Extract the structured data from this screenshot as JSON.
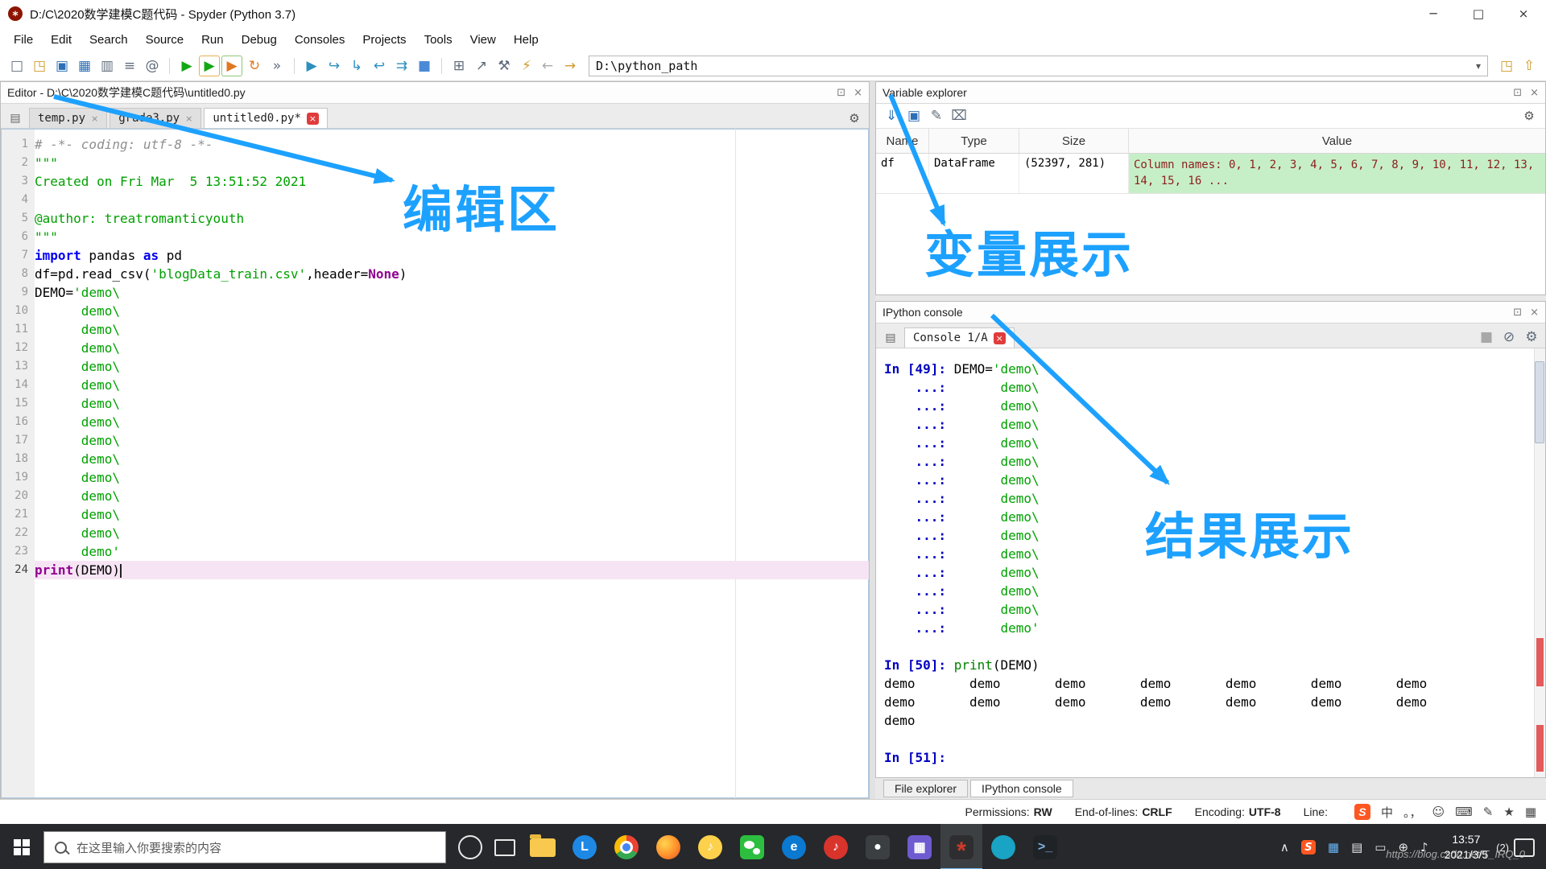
{
  "titlebar": {
    "title": "D:/C\\2020数学建模C题代码 - Spyder (Python 3.7)"
  },
  "icons": {
    "logo": "*",
    "minimize": "─",
    "maximize": "□",
    "close_win": "×",
    "close": "×",
    "gear": "⚙",
    "undock": "⊡",
    "browse": "▤",
    "chevron_down": "▾"
  },
  "menubar": {
    "items": [
      "File",
      "Edit",
      "Search",
      "Source",
      "Run",
      "Debug",
      "Consoles",
      "Projects",
      "Tools",
      "View",
      "Help"
    ]
  },
  "toolbar": {
    "path_value": "D:\\python_path",
    "main_icons": [
      {
        "name": "new-file-icon",
        "g": "□",
        "c": "ic-gray"
      },
      {
        "name": "open-file-icon",
        "g": "◳",
        "c": "ic-gold"
      },
      {
        "name": "save-icon",
        "g": "▣",
        "c": "ic-blue"
      },
      {
        "name": "save-all-icon",
        "g": "▦",
        "c": "ic-blue"
      },
      {
        "name": "copy-icon",
        "g": "▥",
        "c": "ic-gray"
      },
      {
        "name": "file-switcher-icon",
        "g": "≡",
        "c": "ic-gray"
      },
      {
        "name": "symbol-finder-icon",
        "g": "@",
        "c": "ic-gray"
      },
      {
        "name": "toolbar-separator",
        "g": "",
        "c": "tb-sep"
      },
      {
        "name": "run-icon",
        "g": "▶",
        "c": "ic-green"
      },
      {
        "name": "run-cell-icon",
        "g": "▶",
        "c": "ic-cell"
      },
      {
        "name": "run-cell-advance-icon",
        "g": "▶",
        "c": "ic-cell2"
      },
      {
        "name": "rerun-icon",
        "g": "↻",
        "c": "ic-orange"
      },
      {
        "name": "more-actions-icon",
        "g": "»",
        "c": "ic-gray"
      },
      {
        "name": "toolbar-separator",
        "g": "",
        "c": "tb-sep"
      },
      {
        "name": "debug-icon",
        "g": "▶",
        "c": "ic-cyan"
      },
      {
        "name": "step-over-icon",
        "g": "↪",
        "c": "ic-cyan"
      },
      {
        "name": "step-into-icon",
        "g": "↳",
        "c": "ic-cyan"
      },
      {
        "name": "step-return-icon",
        "g": "↩",
        "c": "ic-cyan"
      },
      {
        "name": "continue-icon",
        "g": "⇉",
        "c": "ic-cyan"
      },
      {
        "name": "stop-icon",
        "g": "■",
        "c": "ic-stopblue"
      },
      {
        "name": "toolbar-separator",
        "g": "",
        "c": "tb-sep"
      },
      {
        "name": "panes-icon",
        "g": "⊞",
        "c": "ic-gray"
      },
      {
        "name": "fullscreen-icon",
        "g": "↗",
        "c": "ic-gray"
      },
      {
        "name": "tools-icon",
        "g": "⚒",
        "c": "ic-gray"
      },
      {
        "name": "python-env-icon",
        "g": "⚡",
        "c": "ic-gold"
      }
    ],
    "nav_icons": [
      {
        "name": "back-icon",
        "g": "←",
        "c": "ic-dim"
      },
      {
        "name": "forward-icon",
        "g": "→",
        "c": "ic-gold"
      }
    ],
    "right_icons": [
      {
        "name": "browse-directory-icon",
        "g": "◳",
        "c": "ic-gold"
      },
      {
        "name": "parent-directory-icon",
        "g": "⇧",
        "c": "ic-gold"
      }
    ]
  },
  "editor": {
    "title": "Editor - D:\\C\\2020数学建模C题代码\\untitled0.py",
    "tabs": [
      {
        "label": "temp.py"
      },
      {
        "label": "grade3.py"
      },
      {
        "label": "untitled0.py*",
        "active": true
      }
    ],
    "code": [
      {
        "n": "1",
        "segs": [
          {
            "t": "# -*- coding: utf-8 -*-",
            "c": "cm"
          }
        ]
      },
      {
        "n": "2",
        "segs": [
          {
            "t": "\"\"\"",
            "c": "st"
          }
        ]
      },
      {
        "n": "3",
        "segs": [
          {
            "t": "Created on Fri Mar  5 13:51:52 2021",
            "c": "st"
          }
        ]
      },
      {
        "n": "4",
        "segs": []
      },
      {
        "n": "5",
        "segs": [
          {
            "t": "@author: treatromanticyouth",
            "c": "st"
          }
        ]
      },
      {
        "n": "6",
        "segs": [
          {
            "t": "\"\"\"",
            "c": "st"
          }
        ]
      },
      {
        "n": "7",
        "segs": [
          {
            "t": "import",
            "c": "kw"
          },
          {
            "t": " pandas ",
            "c": "tx"
          },
          {
            "t": "as",
            "c": "kw"
          },
          {
            "t": " pd",
            "c": "tx"
          }
        ]
      },
      {
        "n": "8",
        "segs": [
          {
            "t": "df=pd.read_csv(",
            "c": "tx"
          },
          {
            "t": "'blogData_train.csv'",
            "c": "st"
          },
          {
            "t": ",header=",
            "c": "tx"
          },
          {
            "t": "None",
            "c": "bi"
          },
          {
            "t": ")",
            "c": "tx"
          }
        ]
      },
      {
        "n": "9",
        "segs": [
          {
            "t": "DEMO=",
            "c": "tx"
          },
          {
            "t": "'demo\\",
            "c": "st"
          }
        ]
      },
      {
        "n": "10",
        "segs": [
          {
            "t": "      ",
            "c": "tx"
          },
          {
            "t": "demo\\",
            "c": "st"
          }
        ]
      },
      {
        "n": "11",
        "segs": [
          {
            "t": "      ",
            "c": "tx"
          },
          {
            "t": "demo\\",
            "c": "st"
          }
        ]
      },
      {
        "n": "12",
        "segs": [
          {
            "t": "      ",
            "c": "tx"
          },
          {
            "t": "demo\\",
            "c": "st"
          }
        ]
      },
      {
        "n": "13",
        "segs": [
          {
            "t": "      ",
            "c": "tx"
          },
          {
            "t": "demo\\",
            "c": "st"
          }
        ]
      },
      {
        "n": "14",
        "segs": [
          {
            "t": "      ",
            "c": "tx"
          },
          {
            "t": "demo\\",
            "c": "st"
          }
        ]
      },
      {
        "n": "15",
        "segs": [
          {
            "t": "      ",
            "c": "tx"
          },
          {
            "t": "demo\\",
            "c": "st"
          }
        ]
      },
      {
        "n": "16",
        "segs": [
          {
            "t": "      ",
            "c": "tx"
          },
          {
            "t": "demo\\",
            "c": "st"
          }
        ]
      },
      {
        "n": "17",
        "segs": [
          {
            "t": "      ",
            "c": "tx"
          },
          {
            "t": "demo\\",
            "c": "st"
          }
        ]
      },
      {
        "n": "18",
        "segs": [
          {
            "t": "      ",
            "c": "tx"
          },
          {
            "t": "demo\\",
            "c": "st"
          }
        ]
      },
      {
        "n": "19",
        "segs": [
          {
            "t": "      ",
            "c": "tx"
          },
          {
            "t": "demo\\",
            "c": "st"
          }
        ]
      },
      {
        "n": "20",
        "segs": [
          {
            "t": "      ",
            "c": "tx"
          },
          {
            "t": "demo\\",
            "c": "st"
          }
        ]
      },
      {
        "n": "21",
        "segs": [
          {
            "t": "      ",
            "c": "tx"
          },
          {
            "t": "demo\\",
            "c": "st"
          }
        ]
      },
      {
        "n": "22",
        "segs": [
          {
            "t": "      ",
            "c": "tx"
          },
          {
            "t": "demo\\",
            "c": "st"
          }
        ]
      },
      {
        "n": "23",
        "segs": [
          {
            "t": "      ",
            "c": "tx"
          },
          {
            "t": "demo'",
            "c": "st"
          }
        ]
      },
      {
        "n": "24",
        "hl": true,
        "segs": [
          {
            "t": "print",
            "c": "bi"
          },
          {
            "t": "(DEMO)",
            "c": "tx"
          }
        ]
      }
    ]
  },
  "variable_explorer": {
    "title": "Variable explorer",
    "toolbar_icons": [
      {
        "name": "import-data-icon",
        "g": "⇓",
        "c": "ic-blue"
      },
      {
        "name": "save-data-icon",
        "g": "▣",
        "c": "ic-blue"
      },
      {
        "name": "edit-icon",
        "g": "✎",
        "c": "ic-gray"
      },
      {
        "name": "clear-variables-icon",
        "g": "⌧",
        "c": "ic-gray"
      }
    ],
    "columns": [
      "Name",
      "Type",
      "Size",
      "Value"
    ],
    "rows": [
      {
        "name": "df",
        "type": "DataFrame",
        "size": "(52397, 281)",
        "value": "Column names: 0, 1, 2, 3, 4, 5, 6, 7, 8, 9, 10, 11, 12, 13, 14, 15, 16 ..."
      }
    ]
  },
  "console": {
    "title": "IPython console",
    "tab_label": "Console 1/A",
    "toolbar_icons": [
      {
        "name": "interrupt-icon",
        "g": "■",
        "c": "ic-dim"
      },
      {
        "name": "clear-console-icon",
        "g": "⊘",
        "c": "ic-gray"
      },
      {
        "name": "options-gear-icon",
        "g": "⚙",
        "c": "ic-gray"
      }
    ],
    "lines": [
      {
        "segs": [
          {
            "t": "In [49]: ",
            "c": "pr"
          },
          {
            "t": "DEMO=",
            "c": "tx"
          },
          {
            "t": "'demo\\",
            "c": "st"
          }
        ]
      },
      {
        "segs": [
          {
            "t": "    ...: ",
            "c": "pr"
          },
          {
            "t": "      ",
            "c": "tx"
          },
          {
            "t": "demo\\",
            "c": "st"
          }
        ]
      },
      {
        "segs": [
          {
            "t": "    ...: ",
            "c": "pr"
          },
          {
            "t": "      ",
            "c": "tx"
          },
          {
            "t": "demo\\",
            "c": "st"
          }
        ]
      },
      {
        "segs": [
          {
            "t": "    ...: ",
            "c": "pr"
          },
          {
            "t": "      ",
            "c": "tx"
          },
          {
            "t": "demo\\",
            "c": "st"
          }
        ]
      },
      {
        "segs": [
          {
            "t": "    ...: ",
            "c": "pr"
          },
          {
            "t": "      ",
            "c": "tx"
          },
          {
            "t": "demo\\",
            "c": "st"
          }
        ]
      },
      {
        "segs": [
          {
            "t": "    ...: ",
            "c": "pr"
          },
          {
            "t": "      ",
            "c": "tx"
          },
          {
            "t": "demo\\",
            "c": "st"
          }
        ]
      },
      {
        "segs": [
          {
            "t": "    ...: ",
            "c": "pr"
          },
          {
            "t": "      ",
            "c": "tx"
          },
          {
            "t": "demo\\",
            "c": "st"
          }
        ]
      },
      {
        "segs": [
          {
            "t": "    ...: ",
            "c": "pr"
          },
          {
            "t": "      ",
            "c": "tx"
          },
          {
            "t": "demo\\",
            "c": "st"
          }
        ]
      },
      {
        "segs": [
          {
            "t": "    ...: ",
            "c": "pr"
          },
          {
            "t": "      ",
            "c": "tx"
          },
          {
            "t": "demo\\",
            "c": "st"
          }
        ]
      },
      {
        "segs": [
          {
            "t": "    ...: ",
            "c": "pr"
          },
          {
            "t": "      ",
            "c": "tx"
          },
          {
            "t": "demo\\",
            "c": "st"
          }
        ]
      },
      {
        "segs": [
          {
            "t": "    ...: ",
            "c": "pr"
          },
          {
            "t": "      ",
            "c": "tx"
          },
          {
            "t": "demo\\",
            "c": "st"
          }
        ]
      },
      {
        "segs": [
          {
            "t": "    ...: ",
            "c": "pr"
          },
          {
            "t": "      ",
            "c": "tx"
          },
          {
            "t": "demo\\",
            "c": "st"
          }
        ]
      },
      {
        "segs": [
          {
            "t": "    ...: ",
            "c": "pr"
          },
          {
            "t": "      ",
            "c": "tx"
          },
          {
            "t": "demo\\",
            "c": "st"
          }
        ]
      },
      {
        "segs": [
          {
            "t": "    ...: ",
            "c": "pr"
          },
          {
            "t": "      ",
            "c": "tx"
          },
          {
            "t": "demo\\",
            "c": "st"
          }
        ]
      },
      {
        "segs": [
          {
            "t": "    ...: ",
            "c": "pr"
          },
          {
            "t": "      ",
            "c": "tx"
          },
          {
            "t": "demo'",
            "c": "st"
          }
        ]
      },
      {
        "segs": []
      },
      {
        "segs": [
          {
            "t": "In [50]: ",
            "c": "pr"
          },
          {
            "t": "print",
            "c": "gf"
          },
          {
            "t": "(DEMO)",
            "c": "tx"
          }
        ]
      },
      {
        "segs": [
          {
            "t": "demo       demo       demo       demo       demo       demo       demo",
            "c": "tx"
          }
        ]
      },
      {
        "segs": [
          {
            "t": "demo       demo       demo       demo       demo       demo       demo",
            "c": "tx"
          }
        ]
      },
      {
        "segs": [
          {
            "t": "demo",
            "c": "tx"
          }
        ]
      },
      {
        "segs": []
      },
      {
        "segs": [
          {
            "t": "In [51]: ",
            "c": "pr"
          }
        ]
      }
    ],
    "bottom_tabs": [
      {
        "label": "File explorer"
      },
      {
        "label": "IPython console",
        "active": true
      }
    ]
  },
  "statusbar": {
    "items": [
      {
        "label": "Permissions:",
        "value": "RW"
      },
      {
        "label": "End-of-lines:",
        "value": "CRLF"
      },
      {
        "label": "Encoding:",
        "value": "UTF-8"
      },
      {
        "label": "Line:",
        "value": ""
      }
    ],
    "sogou": "S",
    "ime_icons": [
      {
        "name": "ime-mode-chinese",
        "g": "中"
      },
      {
        "name": "ime-punctuation",
        "g": "。，"
      },
      {
        "name": "smiley-icon",
        "g": "☺"
      },
      {
        "name": "keyboard-icon",
        "g": "⌨"
      },
      {
        "name": "pencil-icon",
        "g": "✎"
      },
      {
        "name": "star-icon",
        "g": "★"
      },
      {
        "name": "grid-icon",
        "g": "▦"
      }
    ]
  },
  "taskbar": {
    "search_placeholder": "在这里输入你要搜索的内容",
    "time": "13:57",
    "date": "2021/3/5",
    "notification": "(2)",
    "watermark": "https://blog.csdn.net/T_IRQ_0",
    "apps": [
      {
        "name": "taskbar-app-file-explorer",
        "g": "",
        "cls": "ic-folder"
      },
      {
        "name": "taskbar-app-blue-l",
        "g": "L",
        "cls": "shp-c",
        "bg": "#1e88e5",
        "fg": "#ffffff"
      },
      {
        "name": "taskbar-app-chrome",
        "g": "",
        "cls": "shp-c ic-chrome"
      },
      {
        "name": "taskbar-app-firefox",
        "g": "",
        "cls": "shp-c ic-firefox"
      },
      {
        "name": "taskbar-app-music",
        "g": "♪",
        "cls": "shp-c",
        "bg": "#fdd14b",
        "fg": "#ffffff"
      },
      {
        "name": "taskbar-app-wechat",
        "g": "",
        "cls": "shp-s ic-wechat"
      },
      {
        "name": "taskbar-app-edge",
        "g": "e",
        "cls": "shp-c",
        "bg": "#0b79d0",
        "fg": "#ffffff"
      },
      {
        "name": "taskbar-app-netease-music",
        "g": "♪",
        "cls": "shp-c",
        "bg": "#d8342c",
        "fg": "#ffffff"
      },
      {
        "name": "taskbar-app-recorder",
        "g": "●",
        "cls": "shp-s",
        "bg": "#3c3f41",
        "fg": "#ffffff"
      },
      {
        "name": "taskbar-app-colorful",
        "g": "▦",
        "cls": "shp-s",
        "bg": "#6f5bd0",
        "fg": "#ffffff"
      },
      {
        "name": "taskbar-app-spyder",
        "g": "*",
        "cls": "shp-s ic-spyder",
        "bg": "#2e2e30",
        "fg": "#d03a2a",
        "active": true
      },
      {
        "name": "taskbar-app-teal",
        "g": "",
        "cls": "shp-c",
        "bg": "#19a3c4"
      },
      {
        "name": "taskbar-app-terminal",
        "g": ">_",
        "cls": "shp-s",
        "bg": "#1f2326",
        "fg": "#7fb2e5"
      }
    ],
    "tray": [
      {
        "name": "hidden-icons-chevron",
        "g": "∧"
      },
      {
        "name": "sogou-tray-icon",
        "g": "S",
        "c": "tr-sogou"
      },
      {
        "name": "security-tray-icon",
        "g": "▦",
        "c": "tr-blue"
      },
      {
        "name": "printer-tray-icon",
        "g": "▤"
      },
      {
        "name": "battery-tray-icon",
        "g": "▭"
      },
      {
        "name": "network-tray-icon",
        "g": "⊕"
      },
      {
        "name": "volume-tray-icon",
        "g": "♪"
      }
    ]
  },
  "annotations": {
    "color": "#1da1ff",
    "editor_label": "编辑区",
    "variables_label": "变量展示",
    "results_label": "结果展示"
  }
}
